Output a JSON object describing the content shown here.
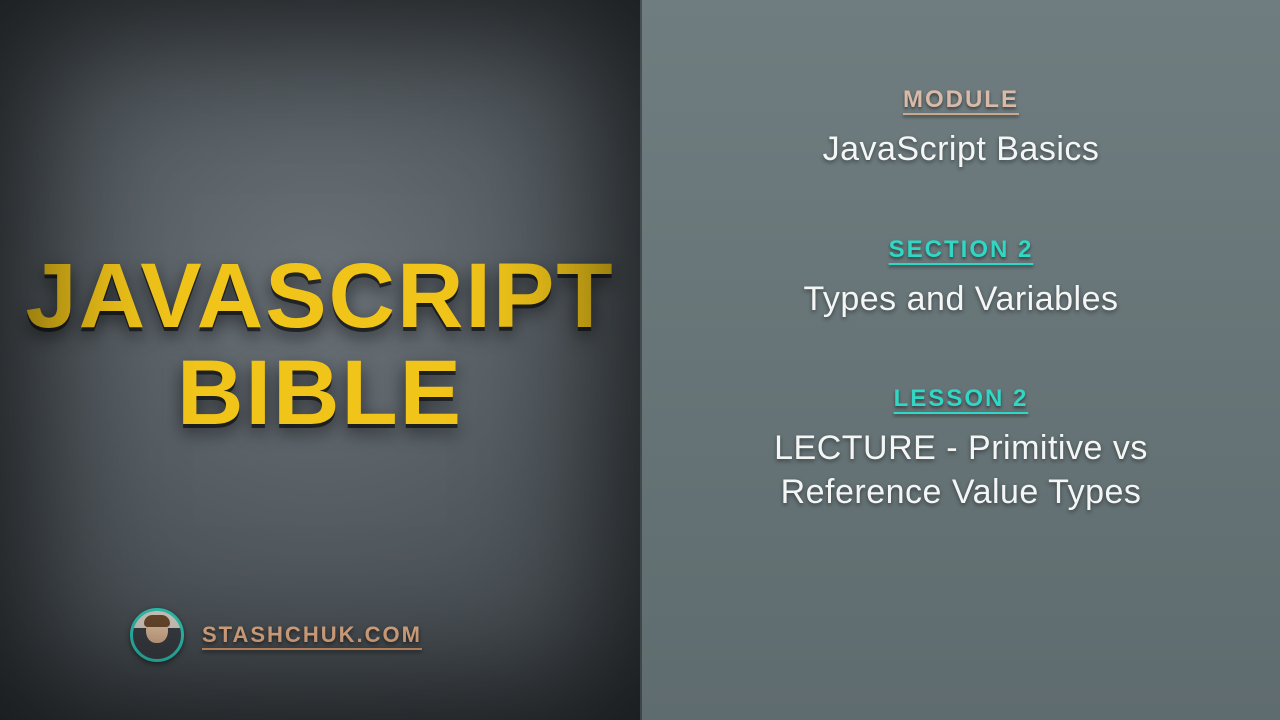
{
  "left": {
    "title_line1": "JAVASCRIPT",
    "title_line2": "BIBLE",
    "site": "STASHCHUK.COM"
  },
  "right": {
    "module": {
      "label": "MODULE",
      "value": "JavaScript Basics"
    },
    "section": {
      "label": "SECTION 2",
      "value": "Types and Variables"
    },
    "lesson": {
      "label": "LESSON 2",
      "value": "LECTURE - Primitive vs Reference Value Types"
    }
  }
}
